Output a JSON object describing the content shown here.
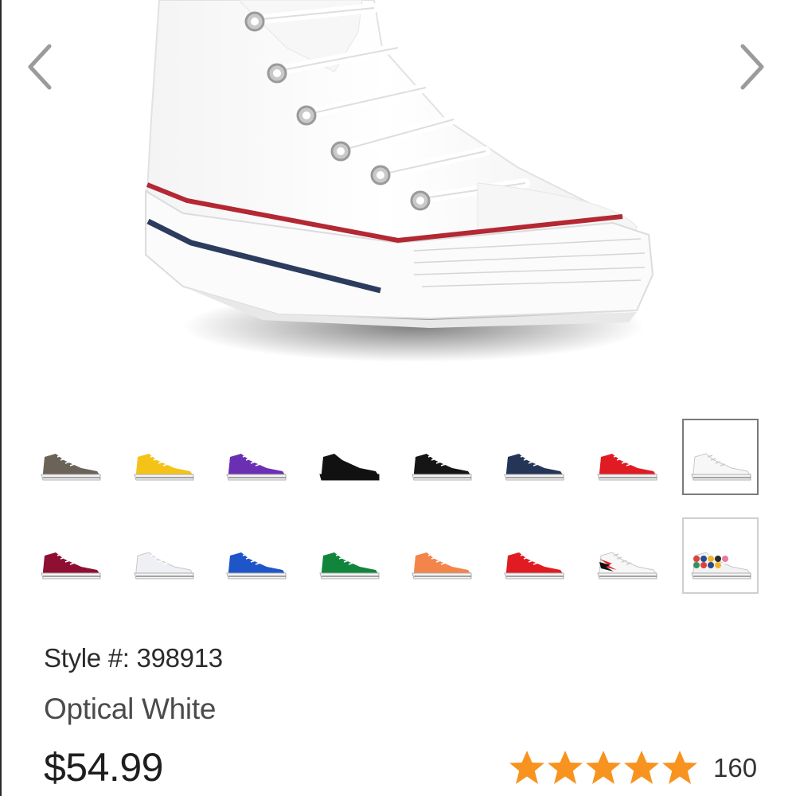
{
  "product": {
    "style_label": "Style #: 398913",
    "color_name": "Optical White",
    "price": "$54.99",
    "rating": {
      "stars": 5,
      "count": "160"
    }
  },
  "carousel": {
    "prev_icon": "chevron-left-icon",
    "next_icon": "chevron-right-icon"
  },
  "colors": {
    "accent_star": "#f7931e",
    "chevron": "#9b9b9b",
    "selected_border": "#7a7a7a"
  },
  "swatches": [
    {
      "color": "#6b6358",
      "style": "plain"
    },
    {
      "color": "#f5c218",
      "style": "plain"
    },
    {
      "color": "#6a2fb3",
      "style": "plain"
    },
    {
      "color": "#111111",
      "style": "mono"
    },
    {
      "color": "#151515",
      "style": "plain"
    },
    {
      "color": "#253558",
      "style": "plain"
    },
    {
      "color": "#e01b24",
      "style": "plain"
    },
    {
      "color": "#f7f7f7",
      "style": "selected"
    },
    {
      "color": "#8f0f32",
      "style": "plain"
    },
    {
      "color": "#eef0f4",
      "style": "plain"
    },
    {
      "color": "#1e55c8",
      "style": "plain"
    },
    {
      "color": "#12853c",
      "style": "plain"
    },
    {
      "color": "#f3854b",
      "style": "plain"
    },
    {
      "color": "#e11b22",
      "style": "plain"
    },
    {
      "color": "#f7f7f7",
      "style": "bolt"
    },
    {
      "color": "#f2f2f2",
      "style": "floral"
    }
  ]
}
